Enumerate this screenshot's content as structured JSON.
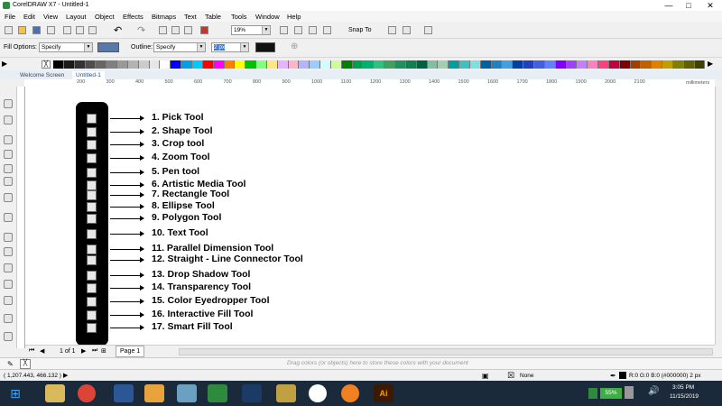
{
  "window": {
    "title": "CorelDRAW X7 - Untitled-1",
    "controls": [
      "—",
      "□",
      "✕"
    ]
  },
  "menu": [
    "File",
    "Edit",
    "View",
    "Layout",
    "Object",
    "Effects",
    "Bitmaps",
    "Text",
    "Table",
    "Tools",
    "Window",
    "Help"
  ],
  "toolbar": {
    "zoom": "19%",
    "snap_to": "Snap To"
  },
  "property_bar": {
    "fill_options_label": "Fill Options:",
    "fill_options_value": "Specify",
    "outline_label": "Outline:",
    "outline_value": "Specify",
    "outline_width": "2 px"
  },
  "palette": [
    "#000000",
    "#1a1a1a",
    "#333333",
    "#4d4d4d",
    "#666666",
    "#808080",
    "#999999",
    "#b3b3b3",
    "#cccccc",
    "#e6e6e6",
    "#ffffff",
    "#0000ff",
    "#00a0e6",
    "#00c8ff",
    "#ff0000",
    "#ff00ff",
    "#ff8000",
    "#ffff00",
    "#00c000",
    "#80ff80",
    "#ffe680",
    "#e6b3ff",
    "#ffb3cc",
    "#b3b3ff",
    "#99ccff",
    "#ccffff",
    "#ccff99",
    "#008000",
    "#00a050",
    "#00b070",
    "#30c080",
    "#40a060",
    "#209060",
    "#108050",
    "#006040",
    "#80c0a0",
    "#a0d0b0",
    "#00a0a0",
    "#40c0c0",
    "#80e0e0",
    "#0060a0",
    "#2080c0",
    "#40a0e0",
    "#0040a0",
    "#2040c0",
    "#4060e0",
    "#6080ff",
    "#8000ff",
    "#a040ff",
    "#c080ff",
    "#ff80c0",
    "#ff4080",
    "#c00040",
    "#800000",
    "#a04000",
    "#c06000",
    "#e08000",
    "#c0a000",
    "#808000",
    "#606000",
    "#404000"
  ],
  "tabs": {
    "welcome": "Welcome Screen",
    "doc": "Untitled-1"
  },
  "ruler": {
    "ticks": [
      "200",
      "300",
      "400",
      "500",
      "600",
      "700",
      "800",
      "900",
      "1000",
      "1100",
      "1200",
      "1300",
      "1400",
      "1500",
      "1600",
      "1700",
      "1800",
      "1900",
      "2000",
      "2100"
    ],
    "units": "millimeters"
  },
  "tools": [
    {
      "label": "1. Pick Tool"
    },
    {
      "label": "2. Shape Tool"
    },
    {
      "label": "3. Crop tool"
    },
    {
      "label": "4. Zoom Tool"
    },
    {
      "label": "5. Pen tool"
    },
    {
      "label": "6. Artistic Media Tool"
    },
    {
      "label": "7. Rectangle Tool"
    },
    {
      "label": "8. Ellipse Tool"
    },
    {
      "label": "9. Polygon Tool"
    },
    {
      "label": "10. Text Tool"
    },
    {
      "label": "11. Parallel Dimension Tool"
    },
    {
      "label": "12. Straight - Line Connector Tool"
    },
    {
      "label": "13. Drop Shadow Tool"
    },
    {
      "label": "14. Transparency Tool"
    },
    {
      "label": "15. Color Eyedropper Tool"
    },
    {
      "label": "16. Interactive Fill Tool"
    },
    {
      "label": "17. Smart Fill Tool"
    }
  ],
  "page_nav": {
    "count": "1 of 1",
    "page_tab": "Page 1"
  },
  "color_well_hint": "Drag colors (or objects) here to store these colors with your document",
  "status": {
    "coords": "( 1,207.443, 466.132 )",
    "fill": "None",
    "outline": "R:0 G:0 B:0 (#000000)  2 px"
  },
  "taskbar": {
    "time": "3:05 PM",
    "date": "11/15/2019",
    "battery": "55%"
  }
}
